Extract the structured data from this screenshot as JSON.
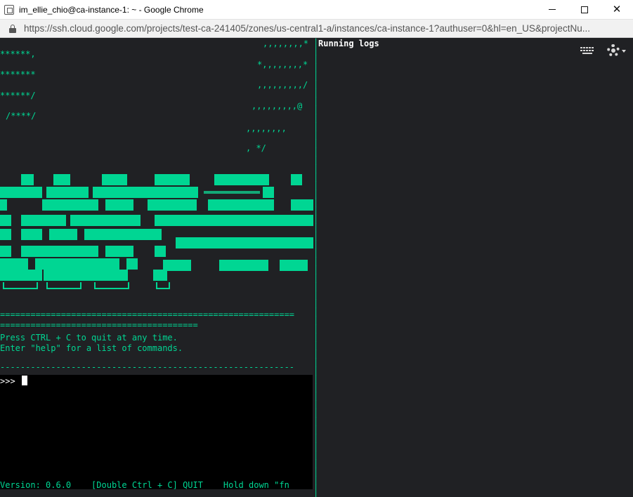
{
  "window": {
    "title": "im_ellie_chio@ca-instance-1: ~ - Google Chrome",
    "minimize": "—",
    "maximize": "☐",
    "close": "✕"
  },
  "address": {
    "url": "https://ssh.cloud.google.com/projects/test-ca-241405/zones/us-central1-a/instances/ca-instance-1?authuser=0&hl=en_US&projectNu..."
  },
  "terminal": {
    "art": [
      ",,,,,,,,*",
      "******,",
      "*,,,,,,,,*",
      "*******",
      ",,,,,,,,,/",
      "******/",
      ",,,,,,,,,@",
      "/****/",
      ",,,,,,,,",
      ", */"
    ],
    "equals_long": "==========================================================",
    "equals_short": "=======================================",
    "instructions": [
      "Press CTRL + C to quit at any time.",
      "Enter \"help\" for a list of commands."
    ],
    "dash_line": "----------------------------------------------------------",
    "prompt": ">>>",
    "status": "Version: 0.6.0    [Double Ctrl + C] QUIT    Hold down \"fn",
    "logs_title": "Running logs"
  },
  "colors": {
    "terminal_bg": "#202124",
    "accent_green": "#00d693"
  }
}
